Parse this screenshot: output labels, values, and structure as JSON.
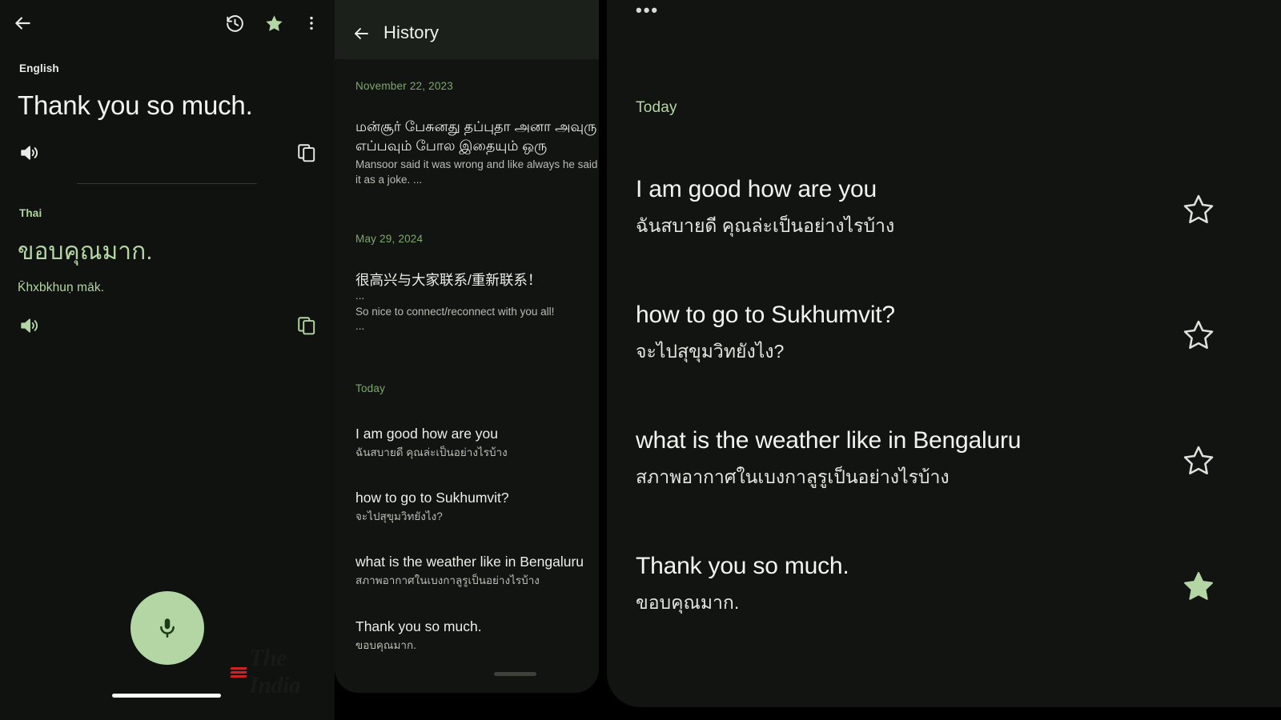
{
  "left_panel": {
    "appbar": {
      "back_icon": "arrow-back-icon",
      "history_icon": "history-clock-icon",
      "star_icon": "star-filled-icon",
      "overflow_icon": "more-vert-icon"
    },
    "source": {
      "language": "English",
      "text": "Thank you so much.",
      "speak_icon": "volume-up-icon",
      "copy_icon": "content-copy-icon"
    },
    "target": {
      "language": "Thai",
      "text": "ขอบคุณมาก.",
      "transliteration": "K̄hxbkhuṇ māk.",
      "speak_icon": "volume-up-icon",
      "copy_icon": "content-copy-icon"
    },
    "mic_button": {
      "icon": "microphone-icon",
      "color": "#b4d6a4"
    },
    "watermark": "The India"
  },
  "middle_panel": {
    "title": "History",
    "back_icon": "arrow-back-icon",
    "groups": [
      {
        "date": "November 22, 2023",
        "entries": [
          {
            "source": "மன்சூர் பேசுனது தப்புதா அனா அவுரு எப்பவும் போல இதையும் ஒரு",
            "target": "Mansoor said it was wrong and like always he said it as a joke. ...",
            "ellipsis_source": "",
            "ellipsis_target": ""
          }
        ]
      },
      {
        "date": "May 29, 2024",
        "entries": [
          {
            "source": "很高兴与大家联系/重新联系！",
            "target": "So nice to connect/reconnect with you all!",
            "ellipsis_source": "...",
            "ellipsis_target": "..."
          }
        ]
      },
      {
        "date": "Today",
        "entries": [
          {
            "source": "I am good how are you",
            "target": "ฉันสบายดี คุณล่ะเป็นอย่างไรบ้าง"
          },
          {
            "source": "how to go to Sukhumvit?",
            "target": "จะไปสุขุมวิทยังไง?"
          },
          {
            "source": "what is the weather like in Bengaluru",
            "target": "สภาพอากาศในเบงกาลูรูเป็นอย่างไรบ้าง"
          },
          {
            "source": "Thank you so much.",
            "target": "ขอบคุณมาก."
          }
        ]
      }
    ]
  },
  "right_panel": {
    "ellipsis": "•••",
    "today_label": "Today",
    "entries": [
      {
        "source": "I am good how are you",
        "target": "ฉันสบายดี คุณล่ะเป็นอย่างไรบ้าง",
        "starred": false,
        "star_icon": "star-outline-icon"
      },
      {
        "source": "how to go to Sukhumvit?",
        "target": "จะไปสุขุมวิทยังไง?",
        "starred": false,
        "star_icon": "star-outline-icon"
      },
      {
        "source": "what is the weather like in Bengaluru",
        "target": "สภาพอากาศในเบงกาลูรูเป็นอย่างไรบ้าง",
        "starred": false,
        "star_icon": "star-outline-icon"
      },
      {
        "source": "Thank you so much.",
        "target": "ขอบคุณมาก.",
        "starred": true,
        "star_icon": "star-filled-icon"
      }
    ]
  },
  "colors": {
    "background": "#000000",
    "panel_dark": "#0f120e",
    "panel_mid": "#111410",
    "appbar_mid": "#1b211a",
    "accent_green": "#b4d6a4",
    "date_green": "#7fa86c",
    "text_primary": "#f2f4ef",
    "text_secondary": "#b9bdb3"
  }
}
